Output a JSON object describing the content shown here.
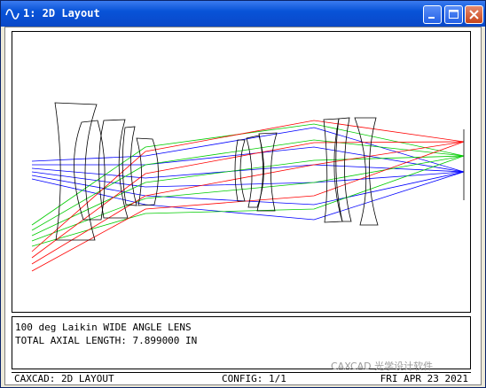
{
  "window": {
    "title": "1: 2D Layout",
    "icon": "sine-wave-icon",
    "controls": [
      "minimize",
      "maximize",
      "close"
    ]
  },
  "layout": {
    "description_line": "100 deg Laikin WIDE ANGLE LENS",
    "length_line": "TOTAL AXIAL LENGTH: 7.899000 IN"
  },
  "status": {
    "left": "CAXCAD: 2D LAYOUT",
    "center": "CONFIG: 1/1",
    "right": "FRI APR 23 2021"
  },
  "watermark": "CAXCAD 光学设计软件",
  "colors": {
    "title_bar": "#0853d8",
    "ray_field_1": "#0000ff",
    "ray_field_2": "#00cc00",
    "ray_field_3": "#ff0000",
    "lens": "#000000"
  }
}
